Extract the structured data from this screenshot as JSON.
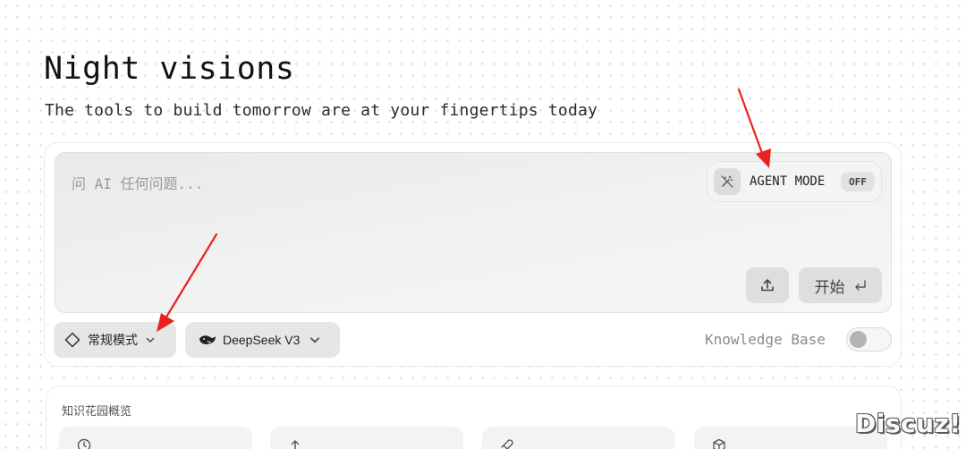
{
  "header": {
    "title": "Night visions",
    "subtitle": "The tools to build tomorrow are at your fingertips today"
  },
  "prompt": {
    "placeholder": "问 AI 任何问题...",
    "agent_mode_label": "AGENT MODE",
    "agent_mode_state": "OFF",
    "start_label": "开始",
    "icons": {
      "agent": "magic-wand-off-icon",
      "upload": "upload-icon",
      "enter": "enter-key-icon"
    }
  },
  "controls": {
    "mode_label": "常规模式",
    "model_label": "DeepSeek V3",
    "knowledge_base_label": "Knowledge Base",
    "knowledge_base_on": false
  },
  "knowledge_garden": {
    "title": "知识花园概览",
    "tiles": [
      {
        "icon": "clock-icon"
      },
      {
        "icon": "upload-icon"
      },
      {
        "icon": "rocket-icon"
      },
      {
        "icon": "cube-icon"
      }
    ]
  },
  "watermark": "Discuz!",
  "colors": {
    "annotation_arrow": "#e8231f",
    "panel": "#eeeeee"
  }
}
